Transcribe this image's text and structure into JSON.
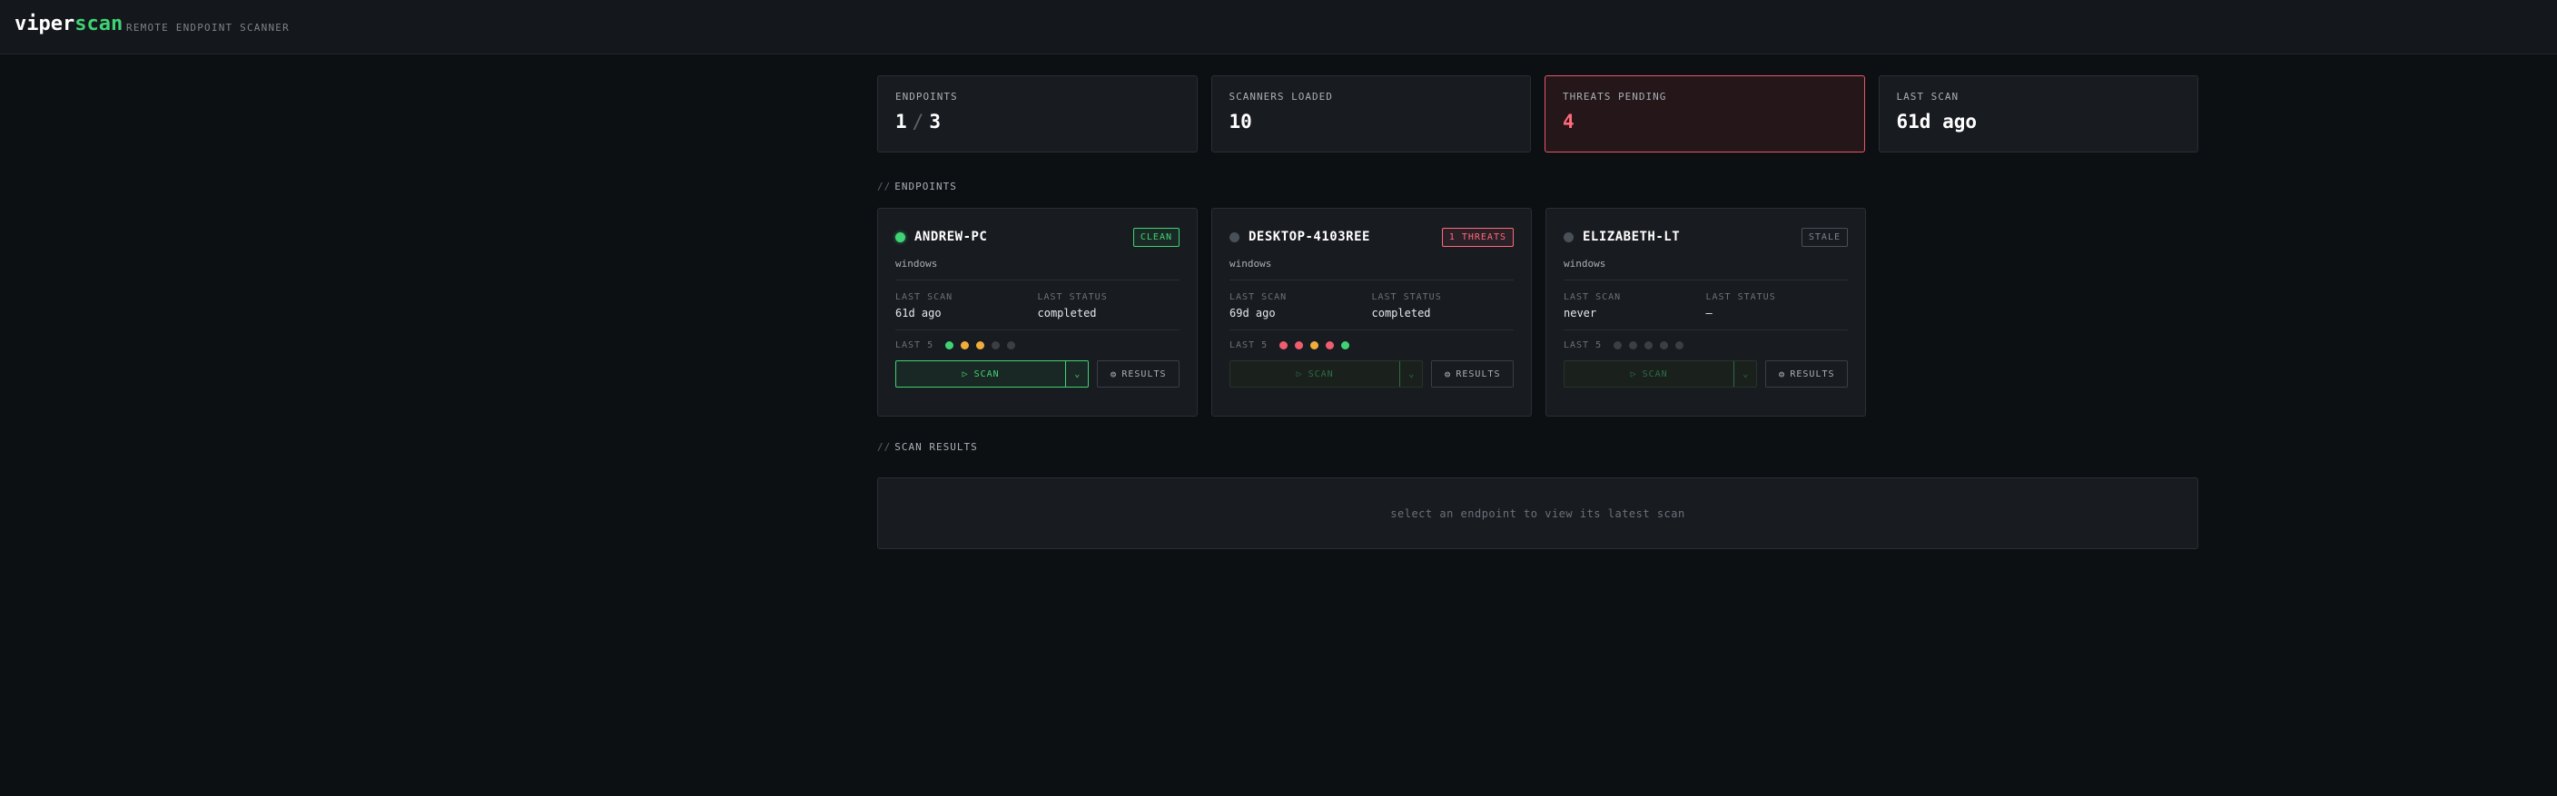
{
  "app": {
    "brand_a": "viper",
    "brand_b": "scan",
    "tagline": "REMOTE ENDPOINT SCANNER"
  },
  "stats": [
    {
      "label": "ENDPOINTS",
      "value": "1",
      "value_total": "3"
    },
    {
      "label": "SCANNERS LOADED",
      "value": "10"
    },
    {
      "label": "THREATS PENDING",
      "value": "4"
    },
    {
      "label": "LAST SCAN",
      "value": "61d ago"
    }
  ],
  "sections": {
    "prefix": "//",
    "endpoints": "ENDPOINTS",
    "results": "SCAN RESULTS"
  },
  "labels": {
    "last_scan": "LAST SCAN",
    "last_status": "LAST STATUS",
    "last5": "LAST 5",
    "scan": "SCAN",
    "results": "RESULTS",
    "scan_icon": "▷",
    "dropdown_icon": "⌄",
    "results_icon": "⊜"
  },
  "endpoints": [
    {
      "host": "ANDREW-PC",
      "online": true,
      "badge": "CLEAN",
      "badge_kind": "clean",
      "os": "windows",
      "last_scan": "61d ago",
      "last_status": "completed",
      "history": [
        "green",
        "amber",
        "amber",
        "gray",
        "gray"
      ],
      "scan_enabled": true
    },
    {
      "host": "DESKTOP-4103REE",
      "online": false,
      "badge": "1 THREATS",
      "badge_kind": "threat",
      "os": "windows",
      "last_scan": "69d ago",
      "last_status": "completed",
      "history": [
        "red",
        "red",
        "amber",
        "red",
        "green"
      ],
      "scan_enabled": false
    },
    {
      "host": "ELIZABETH-LT",
      "online": false,
      "badge": "STALE",
      "badge_kind": "stale",
      "os": "windows",
      "last_scan": "never",
      "last_status": "—",
      "history": [
        "gray",
        "gray",
        "gray",
        "gray",
        "gray"
      ],
      "scan_enabled": false
    }
  ],
  "results": {
    "empty_message": "select an endpoint to view its latest scan"
  },
  "colors": {
    "accent": "#3fd373",
    "danger": "#ff6b7a",
    "warning": "#f0ad3c",
    "background": "#0d1013"
  }
}
